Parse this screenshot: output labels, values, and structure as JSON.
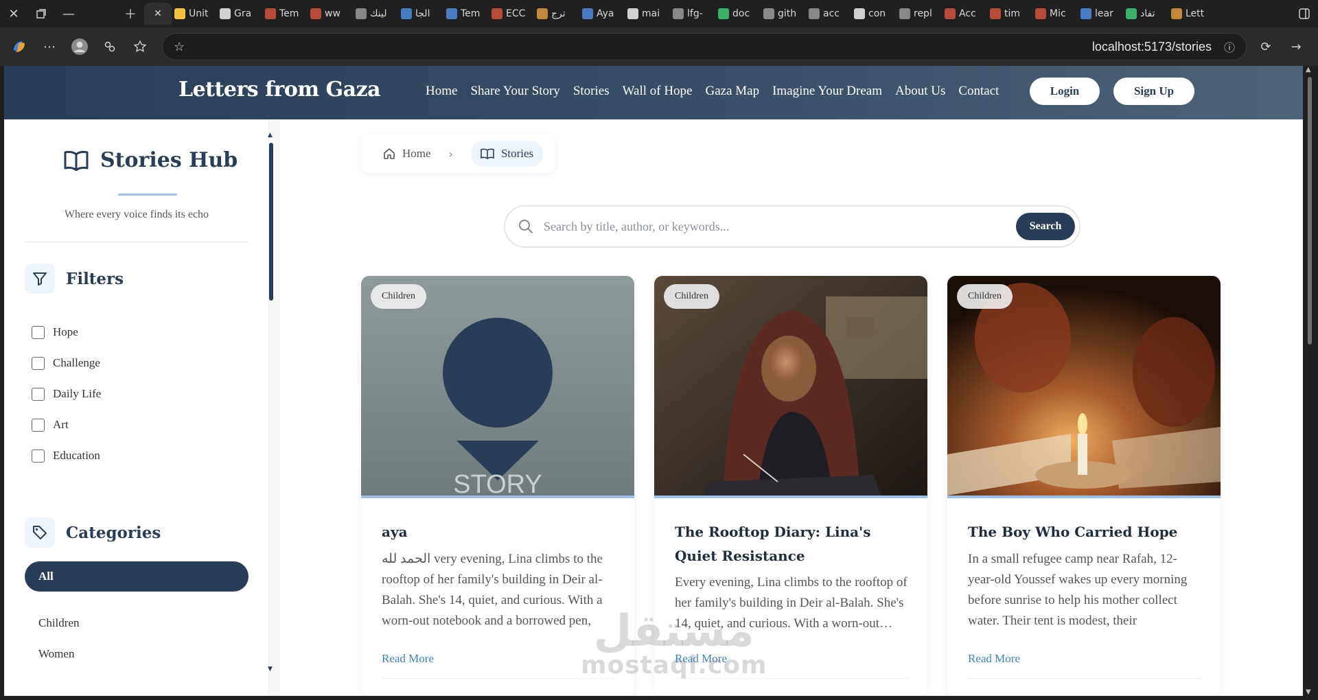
{
  "browser": {
    "tabs": [
      {
        "label": "Unit",
        "color": "#f0c040"
      },
      {
        "label": "Gra",
        "color": "#d0d0d0"
      },
      {
        "label": "Tem",
        "color": "#b84a3a"
      },
      {
        "label": "ww",
        "color": "#b84a3a"
      },
      {
        "label": "لينك",
        "color": "#888888"
      },
      {
        "label": "الجا",
        "color": "#4a7cc4"
      },
      {
        "label": "Tem",
        "color": "#4a7cc4"
      },
      {
        "label": "ECC",
        "color": "#b84a3a"
      },
      {
        "label": "ترج",
        "color": "#c08a3a"
      },
      {
        "label": "Aya",
        "color": "#4a7cc4"
      },
      {
        "label": "mai",
        "color": "#d0d0d0"
      },
      {
        "label": "lfg-",
        "color": "#888888"
      },
      {
        "label": "doc",
        "color": "#3ab06a"
      },
      {
        "label": "gith",
        "color": "#888888"
      },
      {
        "label": "acc",
        "color": "#888888"
      },
      {
        "label": "con",
        "color": "#d0d0d0"
      },
      {
        "label": "repl",
        "color": "#888888"
      },
      {
        "label": "Acc",
        "color": "#b84a3a"
      },
      {
        "label": "tim",
        "color": "#b84a3a"
      },
      {
        "label": "Mic",
        "color": "#b84a3a"
      },
      {
        "label": "lear",
        "color": "#4a7cc4"
      },
      {
        "label": "تفاد",
        "color": "#3ab06a"
      },
      {
        "label": "Lett",
        "color": "#c08a3a"
      }
    ],
    "url": "localhost:5173/stories"
  },
  "site": {
    "brand": "Letters from Gaza",
    "nav": [
      "Home",
      "Share Your Story",
      "Stories",
      "Wall of Hope",
      "Gaza Map",
      "Imagine Your Dream",
      "About Us",
      "Contact"
    ],
    "login": "Login",
    "signup": "Sign Up"
  },
  "sidebar": {
    "title": "Stories Hub",
    "subtitle": "Where every voice finds its echo",
    "filters_title": "Filters",
    "filters": [
      "Hope",
      "Challenge",
      "Daily Life",
      "Art",
      "Education"
    ],
    "categories_title": "Categories",
    "categories": [
      "All",
      "Children",
      "Women"
    ]
  },
  "breadcrumb": {
    "home": "Home",
    "current": "Stories"
  },
  "search": {
    "placeholder": "Search by title, author, or keywords...",
    "button": "Search"
  },
  "cards": [
    {
      "badge": "Children",
      "image_text": "STORY",
      "title": "aya",
      "excerpt_prefix": "الحمد لله",
      "excerpt": " very evening, Lina climbs to the rooftop of her family's building in Deir al-Balah. She's 14, quiet, and curious. With a worn-out notebook and a borrowed pen,",
      "read_more": "Read More"
    },
    {
      "badge": "Children",
      "title": "The Rooftop Diary: Lina's Quiet Resistance",
      "excerpt": "Every evening, Lina climbs to the rooftop of her family's building in Deir al-Balah. She's 14, quiet, and curious. With a worn-out notebook and a borrowed pen,",
      "read_more": "Read More"
    },
    {
      "badge": "Children",
      "title": "The Boy Who Carried Hope",
      "excerpt": "In a small refugee camp near Rafah, 12-year-old Youssef wakes up every morning before sunrise to help his mother collect water. Their tent is modest, their",
      "read_more": "Read More"
    }
  ],
  "watermark": {
    "arabic": "مستقل",
    "latin": "mostaql.com"
  },
  "colors": {
    "primary": "#2a3d57",
    "accent": "#9cc0e6",
    "link": "#3b82c4"
  }
}
